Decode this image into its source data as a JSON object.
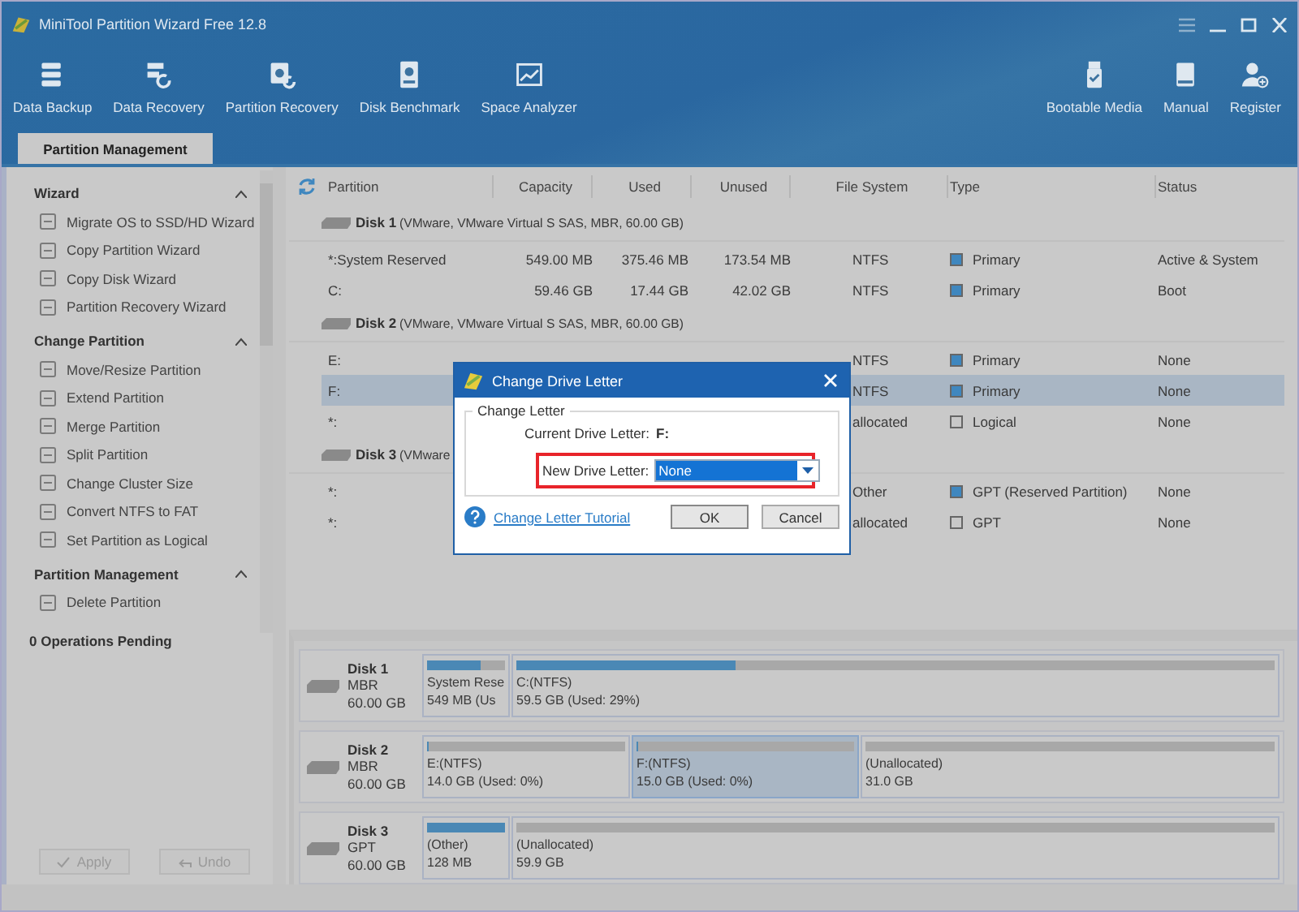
{
  "window": {
    "title": "MiniTool Partition Wizard Free 12.8"
  },
  "toolbar": [
    {
      "label": "Data Backup",
      "kind": "backup"
    },
    {
      "label": "Data Recovery",
      "kind": "recovery"
    },
    {
      "label": "Partition Recovery",
      "kind": "precovery"
    },
    {
      "label": "Disk Benchmark",
      "kind": "benchmark"
    },
    {
      "label": "Space Analyzer",
      "kind": "analyzer"
    }
  ],
  "toolbar_right": [
    {
      "label": "Bootable Media",
      "kind": "usb"
    },
    {
      "label": "Manual",
      "kind": "book"
    },
    {
      "label": "Register",
      "kind": "user"
    }
  ],
  "tabs": [
    {
      "label": "Partition Management",
      "selected": true
    }
  ],
  "sidebar": {
    "sections": [
      {
        "title": "Wizard",
        "expanded": true,
        "items": [
          "Migrate OS to SSD/HD Wizard",
          "Copy Partition Wizard",
          "Copy Disk Wizard",
          "Partition Recovery Wizard"
        ]
      },
      {
        "title": "Change Partition",
        "expanded": true,
        "items": [
          "Move/Resize Partition",
          "Extend Partition",
          "Merge Partition",
          "Split Partition",
          "Change Cluster Size",
          "Convert NTFS to FAT",
          "Set Partition as Logical"
        ]
      },
      {
        "title": "Partition Management",
        "expanded": true,
        "items": [
          "Delete Partition"
        ]
      }
    ],
    "pending": "0 Operations Pending",
    "buttons": [
      {
        "label": "Apply",
        "kind": "apply",
        "disabled": true
      },
      {
        "label": "Undo",
        "kind": "undo",
        "disabled": true
      }
    ]
  },
  "table": {
    "columns": [
      "Partition",
      "Capacity",
      "Used",
      "Unused",
      "File System",
      "Type",
      "Status"
    ],
    "disks": [
      {
        "name": "Disk 1",
        "detail": "(VMware, VMware Virtual S SAS, MBR, 60.00 GB)",
        "rows": [
          {
            "partition": "*:System Reserved",
            "capacity": "549.00 MB",
            "used": "375.46 MB",
            "unused": "173.54 MB",
            "file_system": "NTFS",
            "type": "Primary",
            "color": "#3f87bf",
            "status": "Active & System",
            "selected": false
          },
          {
            "partition": "C:",
            "capacity": "59.46 GB",
            "used": "17.44 GB",
            "unused": "42.02 GB",
            "file_system": "NTFS",
            "type": "Primary",
            "color": "#3f87bf",
            "status": "Boot",
            "selected": false
          }
        ]
      },
      {
        "name": "Disk 2",
        "detail": "(VMware, VMware Virtual S SAS, MBR, 60.00 GB)",
        "rows": [
          {
            "partition": "E:",
            "file_system": "NTFS",
            "type": "Primary",
            "color": "#3f87bf",
            "status": "None",
            "selected": false
          },
          {
            "partition": "F:",
            "file_system": "NTFS",
            "type": "Primary",
            "color": "#3f87bf",
            "status": "None",
            "selected": true
          },
          {
            "partition": "*:",
            "file_system": "allocated",
            "type": "Logical",
            "color": "#c8c8c8",
            "status": "None",
            "selected": false
          }
        ]
      },
      {
        "name": "Disk 3",
        "detail": "(VMware",
        "rows": [
          {
            "partition": "*:",
            "file_system": "Other",
            "type": "GPT (Reserved Partition)",
            "color": "#3f87bf",
            "status": "None",
            "selected": false
          },
          {
            "partition": "*:",
            "file_system": "allocated",
            "type": "GPT",
            "color": "#c8c8c8",
            "status": "None",
            "selected": false
          }
        ]
      }
    ]
  },
  "disk_map": [
    {
      "name": "Disk 1",
      "style": "MBR",
      "size": "60.00 GB",
      "partitions": [
        {
          "label": "System Rese",
          "size": "549 MB (Us",
          "level": 0.68,
          "selected": false
        },
        {
          "label": "C:(NTFS)",
          "size": "59.5 GB (Used: 29%)",
          "level": 0.29,
          "selected": false
        }
      ]
    },
    {
      "name": "Disk 2",
      "style": "MBR",
      "size": "60.00 GB",
      "partitions": [
        {
          "label": "E:(NTFS)",
          "size": "14.0 GB (Used: 0%)",
          "level": 0.01,
          "selected": false
        },
        {
          "label": "F:(NTFS)",
          "size": "15.0 GB (Used: 0%)",
          "level": 0.01,
          "selected": true
        },
        {
          "label": "(Unallocated)",
          "size": "31.0 GB",
          "selected": false
        }
      ]
    },
    {
      "name": "Disk 3",
      "style": "GPT",
      "size": "60.00 GB",
      "partitions": [
        {
          "label": "(Other)",
          "size": "128 MB",
          "level": 1,
          "selected": false
        },
        {
          "label": "(Unallocated)",
          "size": "59.9 GB",
          "selected": false
        }
      ]
    }
  ],
  "dialog": {
    "title": "Change Drive Letter",
    "group": "Change Letter",
    "current_label": "Current Drive Letter:",
    "current_value": "F:",
    "new_label": "New Drive Letter:",
    "new_value": "None",
    "highlighted": true,
    "link": "Change Letter Tutorial",
    "buttons": [
      "OK",
      "Cancel"
    ]
  }
}
